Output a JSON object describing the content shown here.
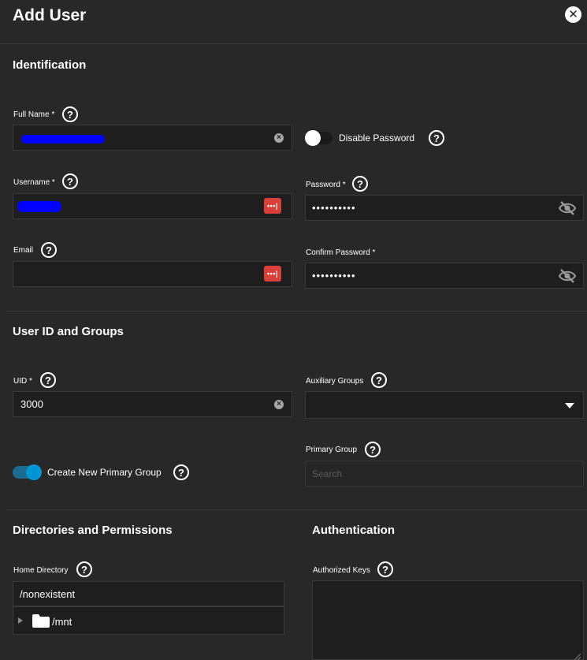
{
  "header": {
    "title": "Add User",
    "close_label": "✕"
  },
  "identification": {
    "section_title": "Identification",
    "full_name_label": "Full Name",
    "full_name_required": "*",
    "disable_password_label": "Disable Password",
    "username_label": "Username",
    "username_required": "*",
    "password_label": "Password",
    "password_required": "*",
    "password_value": "••••••••••",
    "email_label": "Email",
    "confirm_password_label": "Confirm Password",
    "confirm_password_required": "*",
    "confirm_password_value": "••••••••••",
    "disable_password_on": false
  },
  "user_id_groups": {
    "section_title": "User ID and Groups",
    "uid_label": "UID",
    "uid_required": "*",
    "uid_value": "3000",
    "aux_groups_label": "Auxiliary Groups",
    "create_primary_group_label": "Create New Primary Group",
    "create_primary_group_on": true,
    "primary_group_label": "Primary Group",
    "primary_group_placeholder": "Search"
  },
  "directories": {
    "section_title": "Directories and Permissions",
    "home_dir_label": "Home Directory",
    "home_dir_value": "/nonexistent",
    "tree_root": "/mnt"
  },
  "authentication": {
    "section_title": "Authentication",
    "authorized_keys_label": "Authorized Keys"
  },
  "icons": {
    "help": "help-circle-icon",
    "clear": "clear-icon",
    "password_manager": "password-manager-icon",
    "visibility_off": "eye-off-icon",
    "dropdown": "chevron-down-icon",
    "folder": "folder-icon",
    "expand": "expand-arrow-icon",
    "close": "close-icon"
  },
  "colors": {
    "background": "#282828",
    "field": "#1e1e1e",
    "accent": "#0095d5",
    "password_manager": "#d9403a"
  }
}
